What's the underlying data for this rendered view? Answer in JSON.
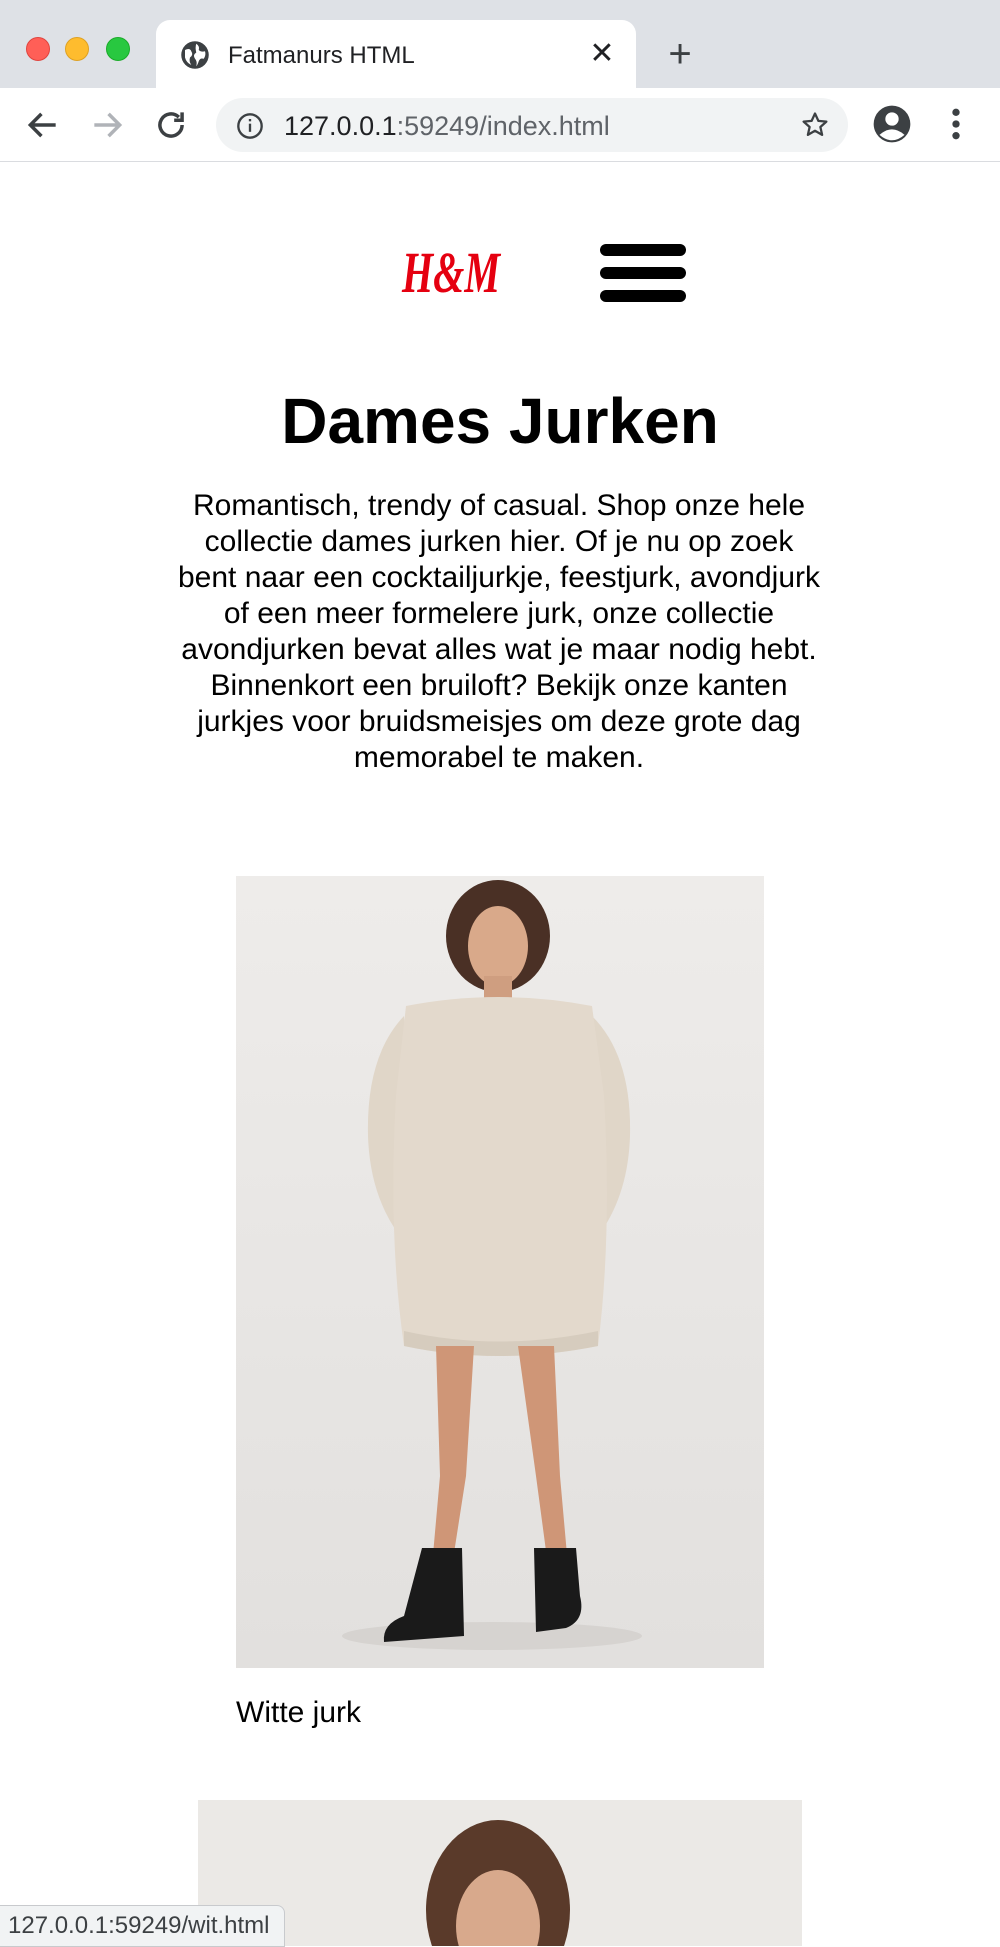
{
  "browser": {
    "tab_title": "Fatmanurs HTML",
    "url_host": "127.0.0.1",
    "url_rest": ":59249/index.html",
    "status_url": "127.0.0.1:59249/wit.html"
  },
  "page": {
    "logo_text": "H&M",
    "title": "Dames Jurken",
    "intro": "Romantisch, trendy of casual. Shop onze hele collectie dames jurken hier. Of je nu op zoek bent naar een cocktailjurkje, feestjurk, avondjurk of een meer formelere jurk, onze collectie avondjurken bevat alles wat je maar nodig hebt. Binnenkort een bruiloft? Bekijk onze kanten jurkjes voor bruidsmeisjes om deze grote dag memorabel te maken.",
    "products": [
      {
        "caption": "Witte jurk"
      }
    ]
  },
  "colors": {
    "brand_red": "#e50010",
    "dress": "#e3d9cc"
  }
}
